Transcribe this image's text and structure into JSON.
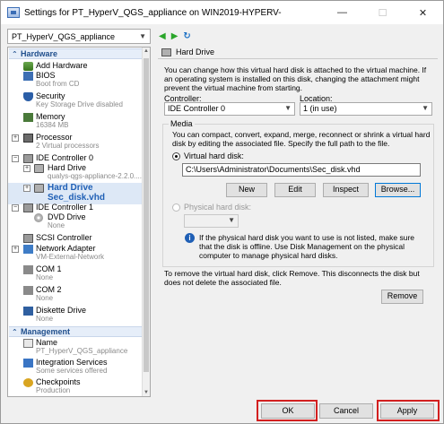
{
  "window": {
    "title": "Settings for PT_HyperV_QGS_appliance on WIN2019-HYPERV-",
    "minimize": "—",
    "maximize": "☐",
    "close": "✕"
  },
  "vm_selector": {
    "value": "PT_HyperV_QGS_appliance"
  },
  "nav": {
    "back": "◀",
    "forward": "▶",
    "refresh": "↻"
  },
  "tree": {
    "hardware_header": "Hardware",
    "management_header": "Management",
    "items": {
      "add_hardware": {
        "name": "Add Hardware"
      },
      "bios": {
        "name": "BIOS",
        "sub": "Boot from CD"
      },
      "security": {
        "name": "Security",
        "sub": "Key Storage Drive disabled"
      },
      "memory": {
        "name": "Memory",
        "sub": "16384 MB"
      },
      "processor": {
        "name": "Processor",
        "sub": "2 Virtual processors"
      },
      "ide0": {
        "name": "IDE Controller 0"
      },
      "hd1": {
        "name": "Hard Drive",
        "sub": "qualys-qgs-appliance-2.2.0...."
      },
      "hd2": {
        "name": "Hard Drive",
        "sub": "Sec_disk.vhd"
      },
      "ide1": {
        "name": "IDE Controller 1"
      },
      "dvd": {
        "name": "DVD Drive",
        "sub": "None"
      },
      "scsi": {
        "name": "SCSI Controller"
      },
      "net": {
        "name": "Network Adapter",
        "sub": "VM-External-Network"
      },
      "com1": {
        "name": "COM 1",
        "sub": "None"
      },
      "com2": {
        "name": "COM 2",
        "sub": "None"
      },
      "diskette": {
        "name": "Diskette Drive",
        "sub": "None"
      },
      "name": {
        "name": "Name",
        "sub": "PT_HyperV_QGS_appliance"
      },
      "integration": {
        "name": "Integration Services",
        "sub": "Some services offered"
      },
      "checkpoints": {
        "name": "Checkpoints",
        "sub": "Production"
      }
    }
  },
  "panel": {
    "header": "Hard Drive",
    "intro": "You can change how this virtual hard disk is attached to the virtual machine. If an operating system is installed on this disk, changing the attachment might prevent the virtual machine from starting.",
    "controller_label": "Controller:",
    "controller_value": "IDE Controller 0",
    "location_label": "Location:",
    "location_value": "1 (in use)",
    "media_title": "Media",
    "media_desc": "You can compact, convert, expand, merge, reconnect or shrink a virtual hard disk by editing the associated file. Specify the full path to the file.",
    "vhd_radio_label": "Virtual hard disk:",
    "vhd_path": "C:\\Users\\Administrator\\Documents\\Sec_disk.vhd",
    "btn_new": "New",
    "btn_edit": "Edit",
    "btn_inspect": "Inspect",
    "btn_browse": "Browse...",
    "phys_radio_label": "Physical hard disk:",
    "phys_info": "If the physical hard disk you want to use is not listed, make sure that the disk is offline. Use Disk Management on the physical computer to manage physical hard disks.",
    "remove_desc": "To remove the virtual hard disk, click Remove. This disconnects the disk but does not delete the associated file.",
    "btn_remove": "Remove"
  },
  "footer": {
    "ok": "OK",
    "cancel": "Cancel",
    "apply": "Apply"
  },
  "colors": {
    "highlight_box": "#d32020",
    "selection": "#dde8f6",
    "accent": "#1f5fb5"
  }
}
